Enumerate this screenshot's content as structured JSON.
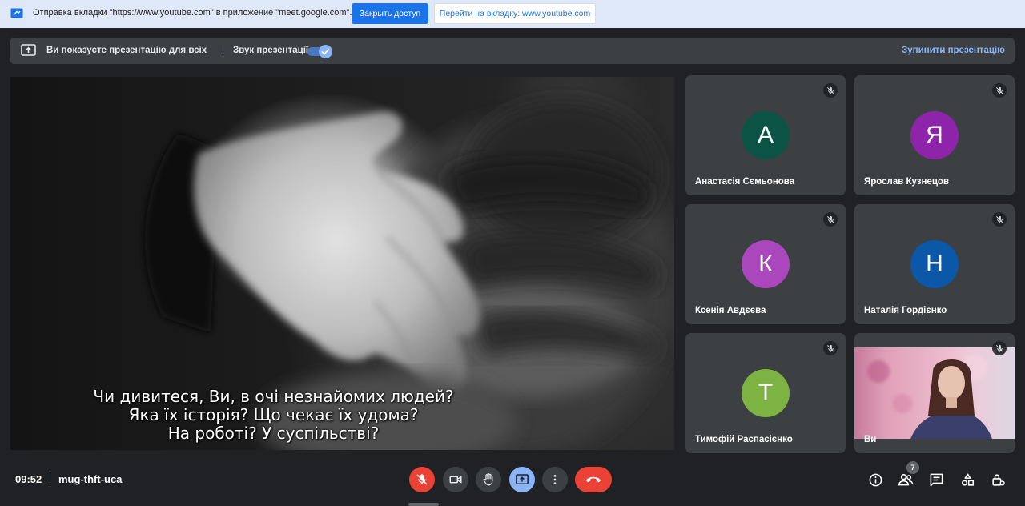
{
  "infobar": {
    "message": "Отправка вкладки \"https://www.youtube.com\" в приложение \"meet.google.com\"...",
    "stop_sharing_label": "Закрыть доступ",
    "goto_tab_label": "Перейти на вкладку: www.youtube.com"
  },
  "presenting_bar": {
    "status": "Ви показуєте презентацію для всіх",
    "audio_label": "Звук презентації",
    "audio_enabled": true,
    "stop_label": "Зупинити презентацію"
  },
  "presentation": {
    "subtitles": [
      "Чи дивитеся, Ви, в очі незнайомих людей?",
      "Яка їх історія? Що чекає їх удома?",
      "На роботі? У суспільстві?"
    ]
  },
  "participants": [
    {
      "initial": "А",
      "name": "Анастасія Сємьонова",
      "color": "#0b5345",
      "muted": true
    },
    {
      "initial": "Я",
      "name": "Ярослав Кузнецов",
      "color": "#8e24aa",
      "muted": true
    },
    {
      "initial": "К",
      "name": "Ксенія Авдєєва",
      "color": "#ab47bc",
      "muted": true
    },
    {
      "initial": "Н",
      "name": "Наталія Гордієнко",
      "color": "#0b57a8",
      "muted": true
    },
    {
      "initial": "Т",
      "name": "Тимофій Распасієнко",
      "color": "#7cb342",
      "muted": true
    },
    {
      "initial": "",
      "name": "Ви",
      "color": "",
      "muted": true
    }
  ],
  "footer": {
    "time": "09:52",
    "meeting_code": "mug-thft-uca",
    "participant_count": "7"
  },
  "icons": {
    "mic": "mic-off-icon",
    "camera": "videocam-icon",
    "hand": "raise-hand-icon",
    "present": "present-screen-icon",
    "more": "more-vert-icon",
    "hangup": "call-end-icon",
    "info": "info-icon",
    "people": "people-icon",
    "chat": "chat-icon",
    "activities": "activities-icon",
    "host": "host-controls-icon"
  },
  "colors": {
    "accent": "#1a73e8",
    "accent_light": "#8ab4f8",
    "danger": "#ea4335",
    "surface": "#3c4043",
    "background": "#202124"
  }
}
